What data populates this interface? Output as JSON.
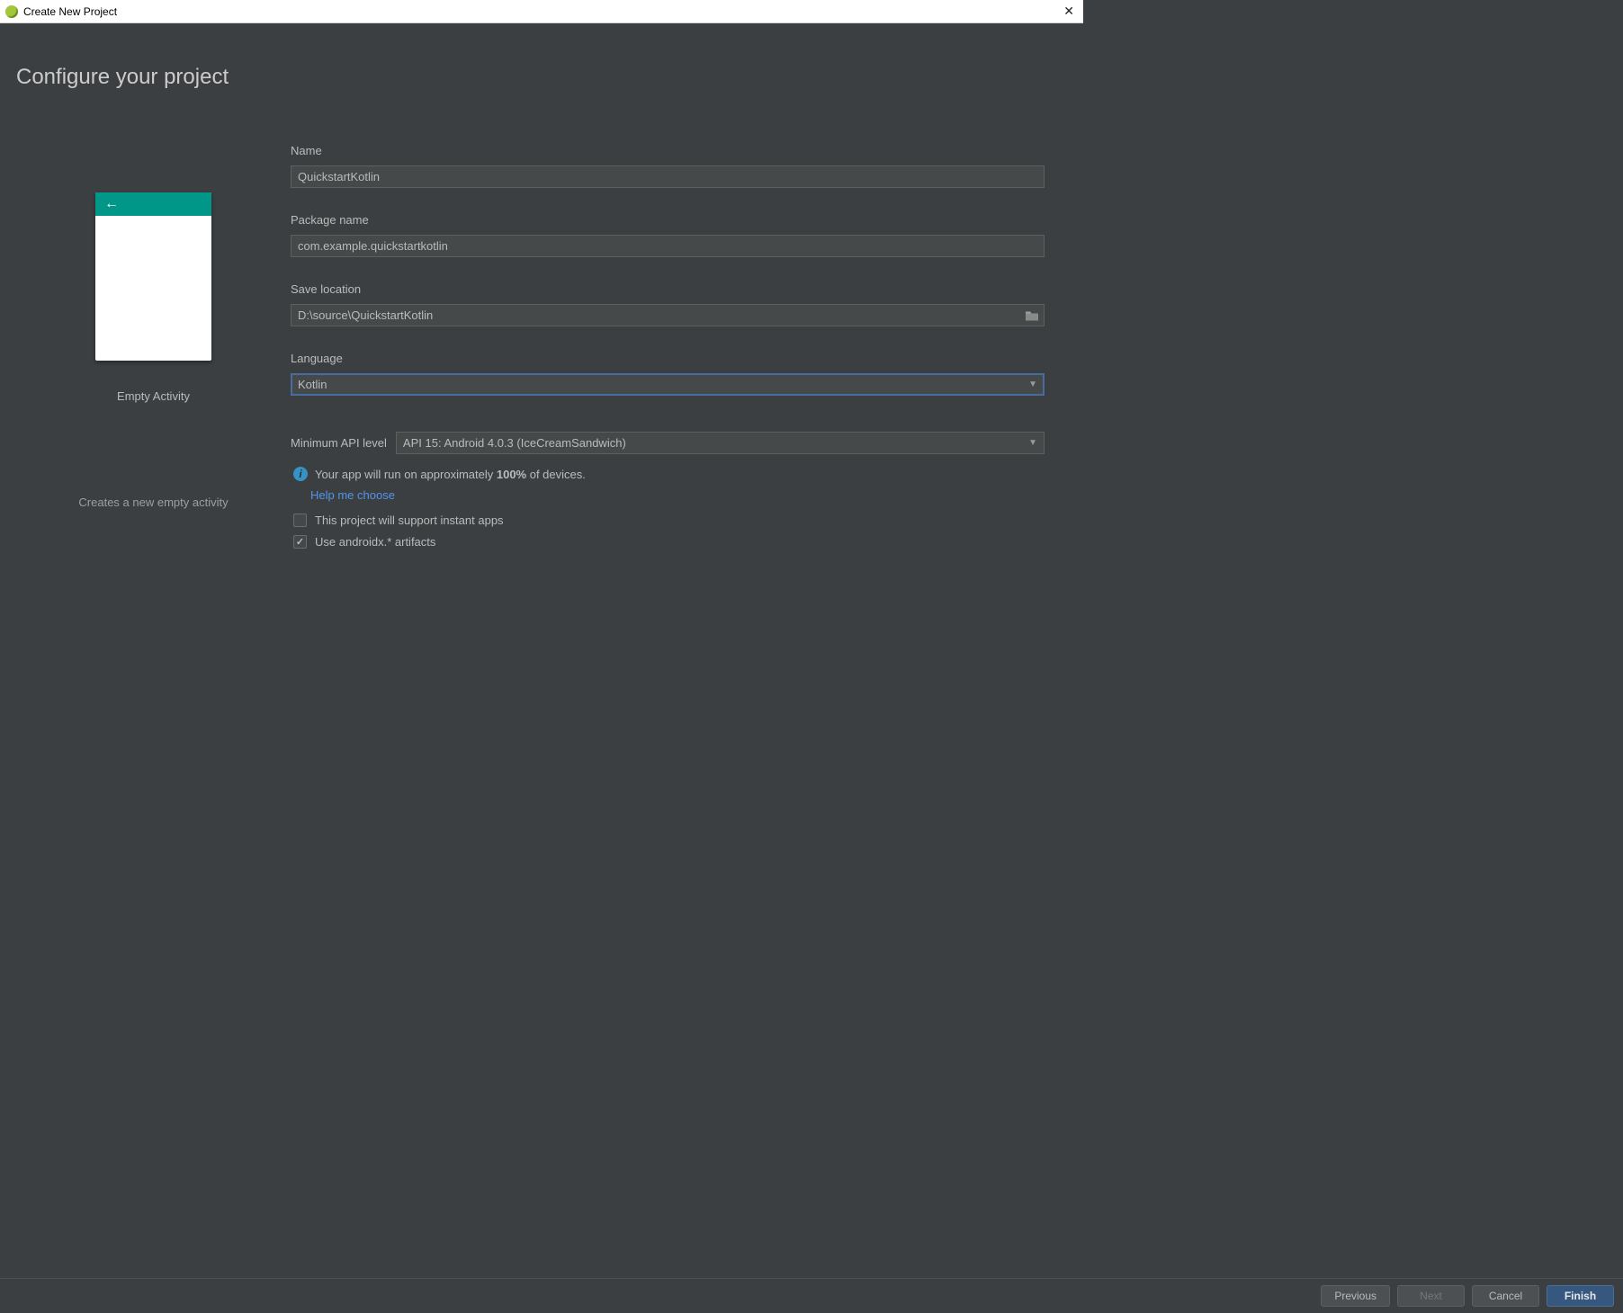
{
  "window": {
    "title": "Create New Project"
  },
  "page": {
    "title": "Configure your project"
  },
  "preview": {
    "label": "Empty Activity",
    "description": "Creates a new empty activity"
  },
  "form": {
    "name_label": "Name",
    "name_value": "QuickstartKotlin",
    "package_label": "Package name",
    "package_value": "com.example.quickstartkotlin",
    "location_label": "Save location",
    "location_value": "D:\\source\\QuickstartKotlin",
    "language_label": "Language",
    "language_value": "Kotlin",
    "api_label": "Minimum API level",
    "api_value": "API 15: Android 4.0.3 (IceCreamSandwich)",
    "info_prefix": "Your app will run on approximately ",
    "info_percent": "100%",
    "info_suffix": " of devices.",
    "help_link": "Help me choose",
    "instant_apps_label": "This project will support instant apps",
    "androidx_label": "Use androidx.* artifacts"
  },
  "footer": {
    "previous": "Previous",
    "next": "Next",
    "cancel": "Cancel",
    "finish": "Finish"
  }
}
